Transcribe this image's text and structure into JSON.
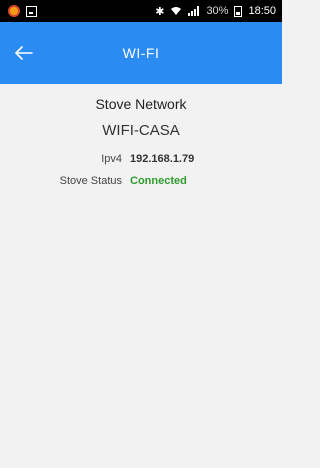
{
  "status_bar": {
    "battery_percent": "30%",
    "time": "18:50"
  },
  "app_bar": {
    "title": "WI-FI",
    "back_icon": "arrow-left-icon"
  },
  "content": {
    "section_title": "Stove Network",
    "network_name": "WIFI-CASA",
    "info": [
      {
        "key": "Ipv4",
        "value": "192.168.1.79"
      },
      {
        "key": "Stove Status",
        "value": "Connected"
      }
    ]
  },
  "colors": {
    "app_bar": "#2a8bf2",
    "background": "#f2f2f2",
    "connected": "#2e9c2e"
  }
}
